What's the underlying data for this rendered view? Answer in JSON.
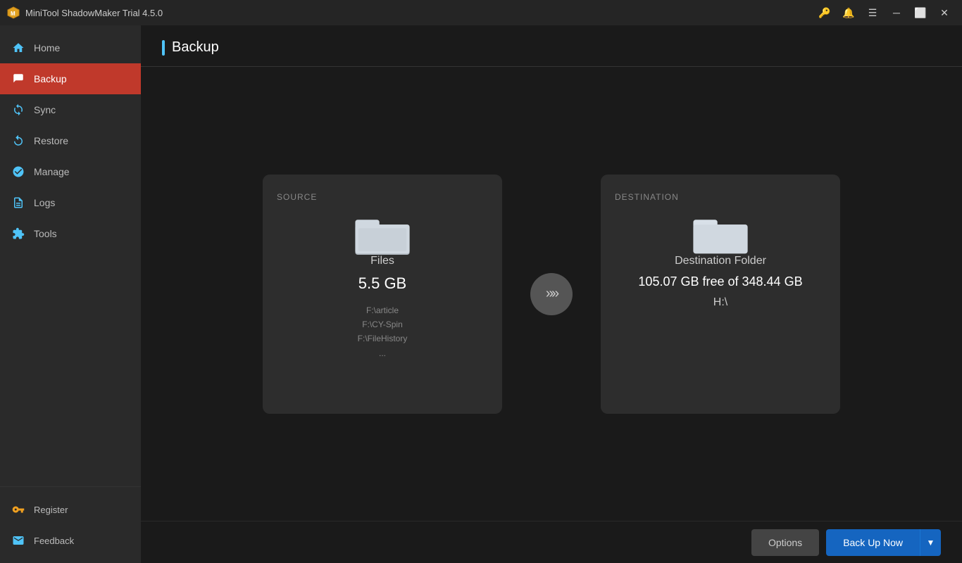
{
  "titlebar": {
    "logo_symbol": "◆",
    "title": "MiniTool ShadowMaker Trial 4.5.0",
    "icons": [
      "key",
      "lock",
      "menu",
      "minimize",
      "restore",
      "close"
    ]
  },
  "sidebar": {
    "nav_items": [
      {
        "id": "home",
        "label": "Home",
        "icon": "🏠",
        "active": false
      },
      {
        "id": "backup",
        "label": "Backup",
        "icon": "📋",
        "active": true
      },
      {
        "id": "sync",
        "label": "Sync",
        "icon": "🔄",
        "active": false
      },
      {
        "id": "restore",
        "label": "Restore",
        "icon": "🔁",
        "active": false
      },
      {
        "id": "manage",
        "label": "Manage",
        "icon": "⚙",
        "active": false
      },
      {
        "id": "logs",
        "label": "Logs",
        "icon": "📄",
        "active": false
      },
      {
        "id": "tools",
        "label": "Tools",
        "icon": "🔧",
        "active": false
      }
    ],
    "bottom_items": [
      {
        "id": "register",
        "label": "Register",
        "icon": "🔑"
      },
      {
        "id": "feedback",
        "label": "Feedback",
        "icon": "✉"
      }
    ]
  },
  "page": {
    "title": "Backup"
  },
  "source": {
    "label": "SOURCE",
    "icon_type": "folder-open",
    "name": "Files",
    "size": "5.5 GB",
    "paths": [
      "F:\\article",
      "F:\\CY-Spin",
      "F:\\FileHistory",
      "..."
    ]
  },
  "destination": {
    "label": "DESTINATION",
    "icon_type": "folder",
    "name": "Destination Folder",
    "free_space": "105.07 GB free of 348.44 GB",
    "drive": "H:\\"
  },
  "footer": {
    "options_label": "Options",
    "backup_now_label": "Back Up Now",
    "dropdown_symbol": "▼"
  }
}
